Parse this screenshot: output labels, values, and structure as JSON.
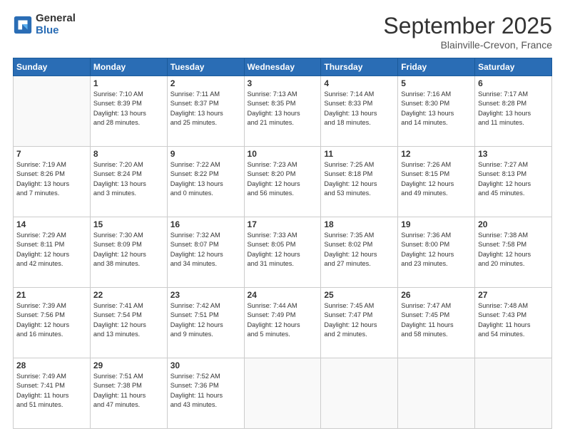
{
  "logo": {
    "general": "General",
    "blue": "Blue"
  },
  "header": {
    "month": "September 2025",
    "location": "Blainville-Crevon, France"
  },
  "weekdays": [
    "Sunday",
    "Monday",
    "Tuesday",
    "Wednesday",
    "Thursday",
    "Friday",
    "Saturday"
  ],
  "weeks": [
    [
      {
        "day": "",
        "info": ""
      },
      {
        "day": "1",
        "info": "Sunrise: 7:10 AM\nSunset: 8:39 PM\nDaylight: 13 hours\nand 28 minutes."
      },
      {
        "day": "2",
        "info": "Sunrise: 7:11 AM\nSunset: 8:37 PM\nDaylight: 13 hours\nand 25 minutes."
      },
      {
        "day": "3",
        "info": "Sunrise: 7:13 AM\nSunset: 8:35 PM\nDaylight: 13 hours\nand 21 minutes."
      },
      {
        "day": "4",
        "info": "Sunrise: 7:14 AM\nSunset: 8:33 PM\nDaylight: 13 hours\nand 18 minutes."
      },
      {
        "day": "5",
        "info": "Sunrise: 7:16 AM\nSunset: 8:30 PM\nDaylight: 13 hours\nand 14 minutes."
      },
      {
        "day": "6",
        "info": "Sunrise: 7:17 AM\nSunset: 8:28 PM\nDaylight: 13 hours\nand 11 minutes."
      }
    ],
    [
      {
        "day": "7",
        "info": "Sunrise: 7:19 AM\nSunset: 8:26 PM\nDaylight: 13 hours\nand 7 minutes."
      },
      {
        "day": "8",
        "info": "Sunrise: 7:20 AM\nSunset: 8:24 PM\nDaylight: 13 hours\nand 3 minutes."
      },
      {
        "day": "9",
        "info": "Sunrise: 7:22 AM\nSunset: 8:22 PM\nDaylight: 13 hours\nand 0 minutes."
      },
      {
        "day": "10",
        "info": "Sunrise: 7:23 AM\nSunset: 8:20 PM\nDaylight: 12 hours\nand 56 minutes."
      },
      {
        "day": "11",
        "info": "Sunrise: 7:25 AM\nSunset: 8:18 PM\nDaylight: 12 hours\nand 53 minutes."
      },
      {
        "day": "12",
        "info": "Sunrise: 7:26 AM\nSunset: 8:15 PM\nDaylight: 12 hours\nand 49 minutes."
      },
      {
        "day": "13",
        "info": "Sunrise: 7:27 AM\nSunset: 8:13 PM\nDaylight: 12 hours\nand 45 minutes."
      }
    ],
    [
      {
        "day": "14",
        "info": "Sunrise: 7:29 AM\nSunset: 8:11 PM\nDaylight: 12 hours\nand 42 minutes."
      },
      {
        "day": "15",
        "info": "Sunrise: 7:30 AM\nSunset: 8:09 PM\nDaylight: 12 hours\nand 38 minutes."
      },
      {
        "day": "16",
        "info": "Sunrise: 7:32 AM\nSunset: 8:07 PM\nDaylight: 12 hours\nand 34 minutes."
      },
      {
        "day": "17",
        "info": "Sunrise: 7:33 AM\nSunset: 8:05 PM\nDaylight: 12 hours\nand 31 minutes."
      },
      {
        "day": "18",
        "info": "Sunrise: 7:35 AM\nSunset: 8:02 PM\nDaylight: 12 hours\nand 27 minutes."
      },
      {
        "day": "19",
        "info": "Sunrise: 7:36 AM\nSunset: 8:00 PM\nDaylight: 12 hours\nand 23 minutes."
      },
      {
        "day": "20",
        "info": "Sunrise: 7:38 AM\nSunset: 7:58 PM\nDaylight: 12 hours\nand 20 minutes."
      }
    ],
    [
      {
        "day": "21",
        "info": "Sunrise: 7:39 AM\nSunset: 7:56 PM\nDaylight: 12 hours\nand 16 minutes."
      },
      {
        "day": "22",
        "info": "Sunrise: 7:41 AM\nSunset: 7:54 PM\nDaylight: 12 hours\nand 13 minutes."
      },
      {
        "day": "23",
        "info": "Sunrise: 7:42 AM\nSunset: 7:51 PM\nDaylight: 12 hours\nand 9 minutes."
      },
      {
        "day": "24",
        "info": "Sunrise: 7:44 AM\nSunset: 7:49 PM\nDaylight: 12 hours\nand 5 minutes."
      },
      {
        "day": "25",
        "info": "Sunrise: 7:45 AM\nSunset: 7:47 PM\nDaylight: 12 hours\nand 2 minutes."
      },
      {
        "day": "26",
        "info": "Sunrise: 7:47 AM\nSunset: 7:45 PM\nDaylight: 11 hours\nand 58 minutes."
      },
      {
        "day": "27",
        "info": "Sunrise: 7:48 AM\nSunset: 7:43 PM\nDaylight: 11 hours\nand 54 minutes."
      }
    ],
    [
      {
        "day": "28",
        "info": "Sunrise: 7:49 AM\nSunset: 7:41 PM\nDaylight: 11 hours\nand 51 minutes."
      },
      {
        "day": "29",
        "info": "Sunrise: 7:51 AM\nSunset: 7:38 PM\nDaylight: 11 hours\nand 47 minutes."
      },
      {
        "day": "30",
        "info": "Sunrise: 7:52 AM\nSunset: 7:36 PM\nDaylight: 11 hours\nand 43 minutes."
      },
      {
        "day": "",
        "info": ""
      },
      {
        "day": "",
        "info": ""
      },
      {
        "day": "",
        "info": ""
      },
      {
        "day": "",
        "info": ""
      }
    ]
  ]
}
